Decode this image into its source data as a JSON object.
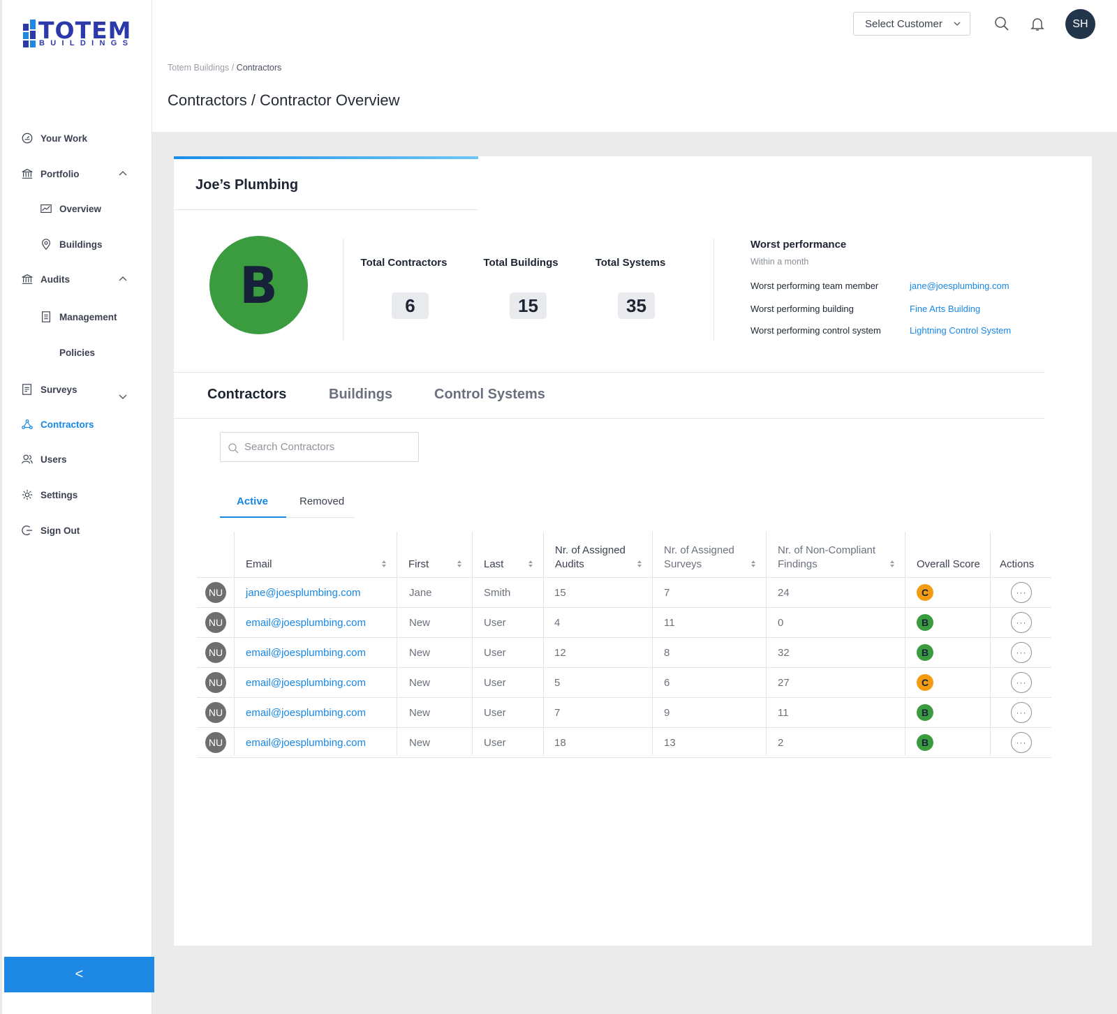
{
  "brand": {
    "name": "TOTEM",
    "sub": "BUILDINGS",
    "colors": {
      "primary": "#2b3aa8",
      "accent": "#1787e6"
    }
  },
  "sidebar": {
    "items": [
      {
        "label": "Your Work",
        "icon": "speedometer-icon"
      },
      {
        "label": "Portfolio",
        "icon": "bank-icon"
      },
      {
        "label": "Overview",
        "icon": "chart-line-icon"
      },
      {
        "label": "Buildings",
        "icon": "map-pin-icon"
      },
      {
        "label": "Audits",
        "icon": "bank-icon"
      },
      {
        "label": "Management",
        "icon": "clipboard-icon"
      },
      {
        "label": "Policies",
        "icon": ""
      },
      {
        "label": "Surveys",
        "icon": "checklist-icon"
      },
      {
        "label": "Contractors",
        "icon": "network-icon"
      },
      {
        "label": "Users",
        "icon": "users-icon"
      },
      {
        "label": "Settings",
        "icon": "gear-icon"
      },
      {
        "label": "Sign Out",
        "icon": "sign-out-icon"
      }
    ],
    "collapse_label": "<"
  },
  "header": {
    "select_customer": "Select Customer",
    "avatar_initials": "SH"
  },
  "breadcrumb": {
    "root": "Totem Buildings",
    "sep": " / ",
    "current": "Contractors"
  },
  "page_title": "Contractors / Contractor Overview",
  "card": {
    "name": "Joe’s Plumbing",
    "grade": "B",
    "grade_color": "#3a9c3f",
    "stats": [
      {
        "label": "Total Contractors",
        "value": "6"
      },
      {
        "label": "Total Buildings",
        "value": "15"
      },
      {
        "label": "Total Systems",
        "value": "35"
      }
    ],
    "worst": {
      "title": "Worst performance",
      "subtitle": "Within a month",
      "rows": [
        {
          "label": "Worst performing team member",
          "value": "jane@joesplumbing.com"
        },
        {
          "label": "Worst performing building",
          "value": "Fine Arts Building"
        },
        {
          "label": "Worst performing control system",
          "value": "Lightning Control System"
        }
      ]
    }
  },
  "tabs": [
    "Contractors",
    "Buildings",
    "Control Systems"
  ],
  "search": {
    "placeholder": "Search Contractors"
  },
  "subtabs": [
    "Active",
    "Removed"
  ],
  "table": {
    "headers": {
      "email": "Email",
      "first": "First",
      "last": "Last",
      "audits_1": "Nr. of Assigned",
      "audits_2": "Audits",
      "surveys_1": "Nr. of Assigned",
      "surveys_2": "Surveys",
      "findings_1": "Nr. of Non-Compliant",
      "findings_2": "Findings",
      "score": "Overall Score",
      "actions": "Actions"
    },
    "rows": [
      {
        "initials": "NU",
        "email": "jane@joesplumbing.com",
        "first": "Jane",
        "last": "Smith",
        "audits": "15",
        "surveys": "7",
        "findings": "24",
        "score": "C",
        "score_color": "#f39c12",
        "actions": "···"
      },
      {
        "initials": "NU",
        "email": "email@joesplumbing.com",
        "first": "New",
        "last": "User",
        "audits": "4",
        "surveys": "11",
        "findings": "0",
        "score": "B",
        "score_color": "#3a9c3f",
        "actions": "···"
      },
      {
        "initials": "NU",
        "email": "email@joesplumbing.com",
        "first": "New",
        "last": "User",
        "audits": "12",
        "surveys": "8",
        "findings": "32",
        "score": "B",
        "score_color": "#3a9c3f",
        "actions": "···"
      },
      {
        "initials": "NU",
        "email": "email@joesplumbing.com",
        "first": "New",
        "last": "User",
        "audits": "5",
        "surveys": "6",
        "findings": "27",
        "score": "C",
        "score_color": "#f39c12",
        "actions": "···"
      },
      {
        "initials": "NU",
        "email": "email@joesplumbing.com",
        "first": "New",
        "last": "User",
        "audits": "7",
        "surveys": "9",
        "findings": "11",
        "score": "B",
        "score_color": "#3a9c3f",
        "actions": "···"
      },
      {
        "initials": "NU",
        "email": "email@joesplumbing.com",
        "first": "New",
        "last": "User",
        "audits": "18",
        "surveys": "13",
        "findings": "2",
        "score": "B",
        "score_color": "#3a9c3f",
        "actions": "···"
      }
    ]
  }
}
